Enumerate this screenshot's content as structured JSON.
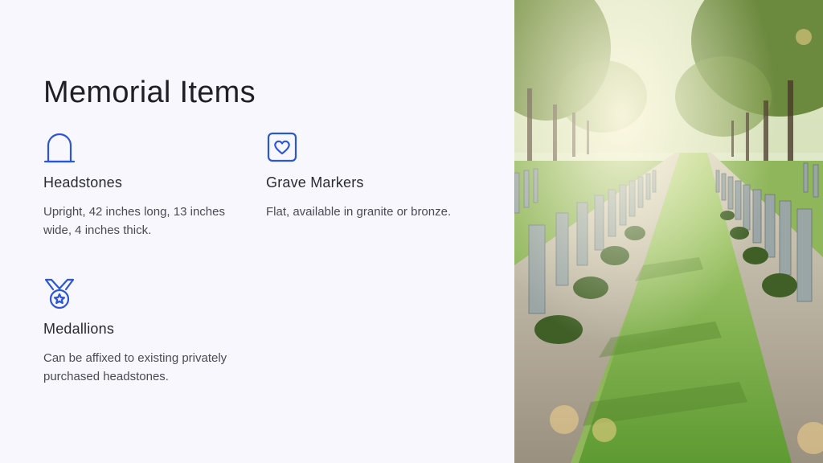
{
  "title": "Memorial Items",
  "items": [
    {
      "icon": "headstone-icon",
      "heading": "Headstones",
      "text": "Upright, 42 inches long, 13 inches wide, 4 inches thick."
    },
    {
      "icon": "heart-frame-icon",
      "heading": "Grave Markers",
      "text": "Flat, available in granite or bronze."
    },
    {
      "icon": "medal-icon",
      "heading": "Medallions",
      "text": "Can be affixed to existing privately purchased headstones."
    }
  ],
  "image": {
    "subject": "cemetery-path-photo"
  },
  "colors": {
    "accent": "#2d56d6",
    "background": "#f8f7fd",
    "title": "#1f1f24"
  }
}
